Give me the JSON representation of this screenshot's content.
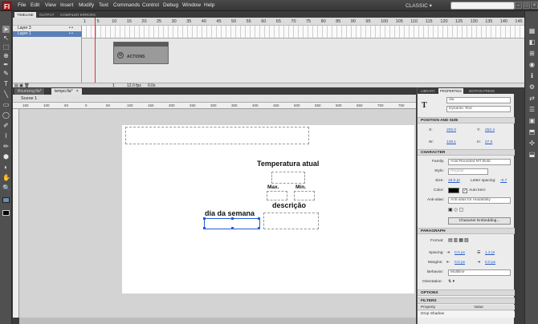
{
  "app": {
    "logo": "Fl",
    "workspace": "CLASSIC ▾"
  },
  "menu": [
    "File",
    "Edit",
    "View",
    "Insert",
    "Modify",
    "Text",
    "Commands",
    "Control",
    "Debug",
    "Window",
    "Help"
  ],
  "window_controls": [
    "–",
    "□",
    "×"
  ],
  "tools": [
    "➤",
    "↖",
    "⬚",
    "⊕",
    "✒",
    "✎",
    "T",
    "╲",
    "▭",
    "◯",
    "✐",
    "⌇",
    "✏",
    "⬢",
    "◐",
    "✋",
    "🔍"
  ],
  "timeline": {
    "tabs": [
      "TIMELINE",
      "OUTPUT",
      "COMPILER ERRORS"
    ],
    "layers": [
      "Layer 3",
      "Layer 1"
    ],
    "frame_numbers": [
      "1",
      "5",
      "10",
      "15",
      "20",
      "25",
      "30",
      "35",
      "40",
      "45",
      "50",
      "55",
      "60",
      "65",
      "70",
      "75",
      "80",
      "85",
      "90",
      "95",
      "100",
      "105",
      "110",
      "115",
      "120",
      "125",
      "130",
      "135",
      "140",
      "145"
    ],
    "footer": {
      "frame": "1",
      "fps": "12.0 fps",
      "time": "0.0s"
    },
    "actions_panel": {
      "label": "ACTIONS",
      "icon": "actions-icon"
    }
  },
  "documents": {
    "tabs": [
      "Bouncing.fla*",
      "tempo.fla*"
    ],
    "active_tab": "tempo.fla*",
    "close_icon": "×"
  },
  "edit_bar": {
    "scene": "Scene 1"
  },
  "ruler": [
    "150",
    "100",
    "50",
    "0",
    "50",
    "100",
    "150",
    "200",
    "250",
    "300",
    "350",
    "400",
    "450",
    "500",
    "550",
    "600",
    "650",
    "700",
    "750"
  ],
  "stage": {
    "title": "Temperatura atual",
    "max": "Max.",
    "min": "Min.",
    "description": "descrição",
    "weekday": "dia da semana"
  },
  "properties": {
    "tabs": [
      "LIBRARY",
      "PROPERTIES",
      "MOTION PRESE"
    ],
    "instance_name_placeholder": "<Instance Name>",
    "instance_name": "dia",
    "text_type": "Dynamic Text",
    "position_header": "POSITION AND SIZE",
    "x_label": "X:",
    "x": "205.0",
    "y_label": "Y:",
    "y": "252.4",
    "w_label": "W:",
    "w": "149.1",
    "h_label": "H:",
    "h": "27.0",
    "character_header": "CHARACTER",
    "family_label": "Family:",
    "family": "Arial Rounded MT Bold",
    "style_label": "Style:",
    "style": "Regular",
    "size_label": "Size:",
    "size": "19.0 pt",
    "letter_spacing_label": "Letter spacing:",
    "letter_spacing": "-0.7",
    "color_label": "Color:",
    "auto_kern": "Auto kern",
    "anti_alias_label": "Anti-alias:",
    "anti_alias": "Anti-alias for readability",
    "embed_button": "Character Embedding...",
    "paragraph_header": "PARAGRAPH",
    "format_label": "Format:",
    "spacing_label": "Spacing:",
    "spacing_indent": "0.0 px",
    "spacing_line": "1.2 pt",
    "margins_label": "Margins:",
    "margin_left": "0.0 px",
    "margin_right": "0.0 px",
    "behavior_label": "Behavior:",
    "behavior": "Multiline",
    "orientation_label": "Orientation:",
    "options_header": "OPTIONS",
    "filters_header": "FILTERS",
    "filters_col_property": "Property",
    "filters_col_value": "Value",
    "filter_item": "Drop Shadow"
  },
  "dock_icons": [
    "▦",
    "◧",
    "⊞",
    "◉",
    "ℹ",
    "⚙",
    "⇄",
    "☰",
    "▣",
    "⬒",
    "✣",
    "⬓"
  ],
  "colors": {
    "text_color": "#000000",
    "accent": "#2b5ec5",
    "playhead": "#e0303a"
  }
}
